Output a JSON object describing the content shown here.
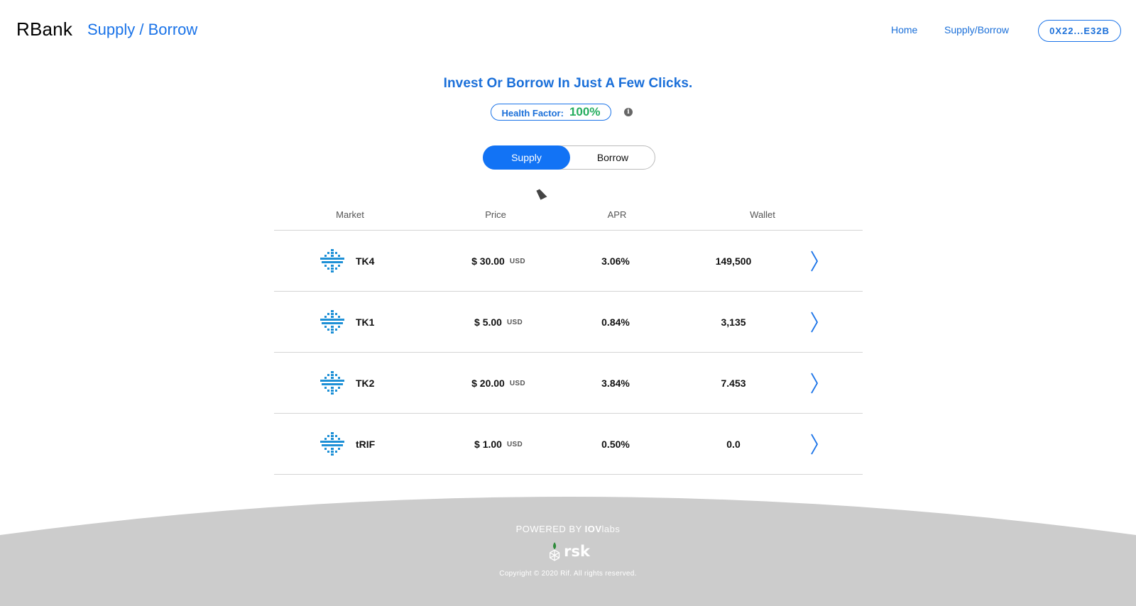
{
  "header": {
    "brand": "RBank",
    "title": "Supply / Borrow",
    "nav": {
      "home": "Home",
      "supply_borrow": "Supply/Borrow"
    },
    "wallet_address": "0X22...E32B"
  },
  "main": {
    "tagline": "Invest Or Borrow In Just A Few Clicks.",
    "health_factor": {
      "label": "Health Factor:",
      "value": "100%"
    },
    "info_icon": "i",
    "toggle": {
      "supply": "Supply",
      "borrow": "Borrow",
      "active": "Supply"
    }
  },
  "table": {
    "columns": {
      "market": "Market",
      "price": "Price",
      "apr": "APR",
      "wallet": "Wallet"
    },
    "rows": [
      {
        "market": "TK4",
        "price": "$ 30.00",
        "unit": "USD",
        "apr": "3.06%",
        "wallet": "149,500"
      },
      {
        "market": "TK1",
        "price": "$ 5.00",
        "unit": "USD",
        "apr": "0.84%",
        "wallet": "3,135"
      },
      {
        "market": "TK2",
        "price": "$ 20.00",
        "unit": "USD",
        "apr": "3.84%",
        "wallet": "7.453"
      },
      {
        "market": "tRIF",
        "price": "$ 1.00",
        "unit": "USD",
        "apr": "0.50%",
        "wallet": "0.0"
      }
    ]
  },
  "footer": {
    "powered_by": "POWERED BY",
    "iov_bold": "IOV",
    "iov_light": "labs",
    "rsk": "rsk",
    "copyright": "Copyright © 2020 Rif. All rights reserved."
  },
  "colors": {
    "accent": "#1a73e8",
    "toggle_active": "#1273f5",
    "health_green": "#27ae60",
    "footer_bg": "#cccccc",
    "token_icon": "#1e90d6"
  },
  "icons": {
    "token": "token-cross-icon",
    "chevron": "chevron-right-icon",
    "info": "info-icon",
    "rsk": "rsk-logo-icon"
  }
}
